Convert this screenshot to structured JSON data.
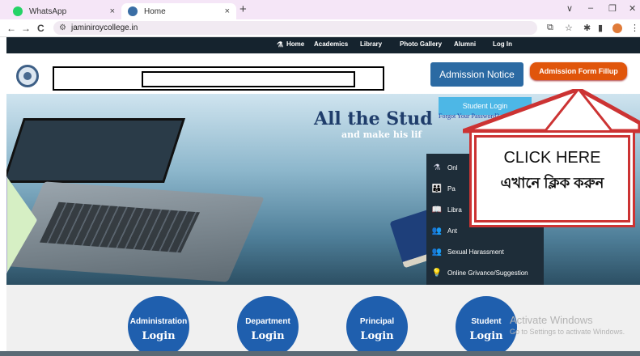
{
  "browser": {
    "tabs": [
      {
        "title": "WhatsApp",
        "close": "×",
        "favicon_color": "#25d366"
      },
      {
        "title": "Home",
        "close": "×",
        "favicon_color": "#3a6ea5"
      }
    ],
    "new_tab": "+",
    "window_controls": {
      "chevron": "∨",
      "minimize": "–",
      "restore": "❐",
      "close": "✕"
    },
    "nav": {
      "back": "←",
      "forward": "→",
      "reload": "C"
    },
    "url": "jaminiroycollege.in",
    "extensions": {
      "cast": "⧉",
      "star": "☆",
      "puzzle": "✱",
      "sidepanel": "▮",
      "menu": "⋮"
    }
  },
  "site": {
    "nav_links": [
      "Home",
      "Academics",
      "Library",
      "Photo Gallery",
      "Alumni",
      "Log In"
    ],
    "admission_notice": "Admission Notice",
    "admission_form": "Admission Form Fillup",
    "tagline_1": "All the Stud",
    "tagline_2": "and make his lif",
    "student_login": "Student Login",
    "forgot_password": "Forgot Your Password?",
    "side_menu": [
      {
        "icon": "⚗",
        "label": "Onl"
      },
      {
        "icon": "👪",
        "label": "Pa"
      },
      {
        "icon": "📖",
        "label": "Libra"
      },
      {
        "icon": "👥",
        "label": "Ant"
      },
      {
        "icon": "👥",
        "label": "Sexual Harassment"
      },
      {
        "icon": "💡",
        "label": "Online Grivance/Suggestion"
      }
    ],
    "callout_en": "CLICK HERE",
    "callout_bn": "এখানে ক্লিক করুন",
    "logins": [
      {
        "top": "Administration",
        "bottom": "Login"
      },
      {
        "top": "Department",
        "bottom": "Login"
      },
      {
        "top": "Principal",
        "bottom": "Login"
      },
      {
        "top": "Student",
        "bottom": "Login"
      }
    ]
  },
  "watermark": {
    "line1": "Activate Windows",
    "line2": "Go to Settings to activate Windows."
  },
  "colors": {
    "accent_orange": "#e0550b",
    "nav_dark": "#15232e",
    "callout_red": "#cc3333"
  }
}
